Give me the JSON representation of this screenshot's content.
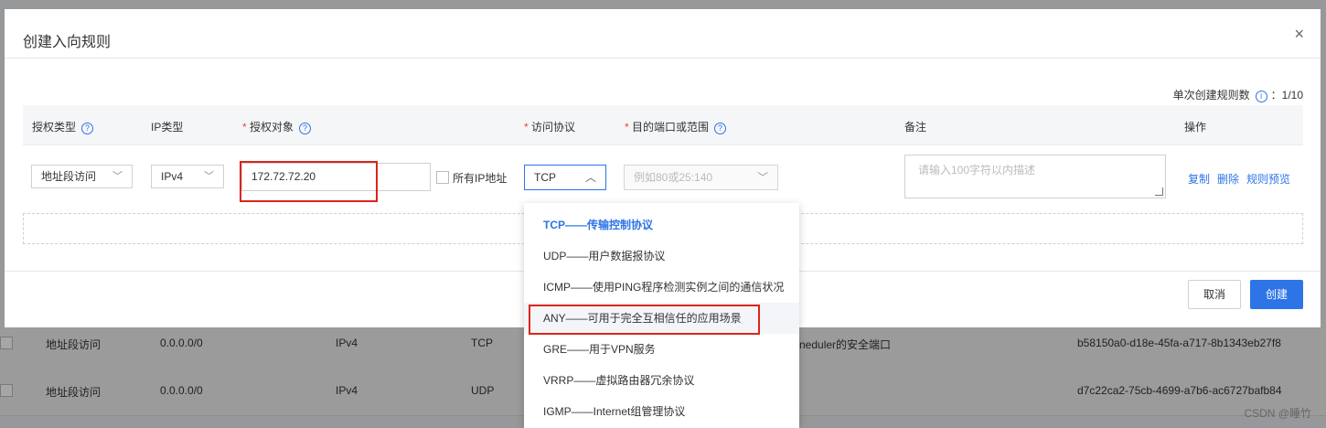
{
  "dialog": {
    "title": "创建入向规则",
    "close_icon": "×",
    "quota_label": "单次创建规则数",
    "quota_value": "：1/10"
  },
  "table": {
    "headers": {
      "auth_type": "授权类型",
      "ip_type": "IP类型",
      "auth_object": "授权对象",
      "protocol": "访问协议",
      "port": "目的端口或范围",
      "note": "备注",
      "action": "操作"
    },
    "row": {
      "auth_type": "地址段访问",
      "ip_type": "IPv4",
      "auth_object_value": "172.72.72.20",
      "all_ip_label": "所有IP地址",
      "protocol": "TCP",
      "port_placeholder": "例如80或25:140",
      "note_placeholder": "请输入100字符以内描述",
      "actions": [
        "复制",
        "删除",
        "规则预览"
      ]
    }
  },
  "footer": {
    "cancel": "取消",
    "create": "创建"
  },
  "protocol_dropdown": {
    "options": [
      "TCP——传输控制协议",
      "UDP——用户数据报协议",
      "ICMP——使用PING程序检测实例之间的通信状况",
      "ANY——可用于完全互相信任的应用场景",
      "GRE——用于VPN服务",
      "VRRP——虚拟路由器冗余协议",
      "IGMP——Internet组管理协议"
    ],
    "selected_index": 0,
    "highlighted_index": 3
  },
  "background_rows": [
    {
      "type": "地址段访问",
      "ip": "0.0.0.0/0",
      "ipver": "IPv4",
      "proto": "TCP",
      "desc": "neduler的安全端口",
      "id": "b58150a0-d18e-45fa-a717-8b1343eb27f8"
    },
    {
      "type": "地址段访问",
      "ip": "0.0.0.0/0",
      "ipver": "IPv4",
      "proto": "UDP",
      "desc": "",
      "id": "d7c22ca2-75cb-4699-a7b6-ac6727bafb84"
    }
  ],
  "watermark": "CSDN @睡竹",
  "colors": {
    "primary": "#2d74e7",
    "required": "#e54545",
    "highlight_border": "#d9261c"
  }
}
